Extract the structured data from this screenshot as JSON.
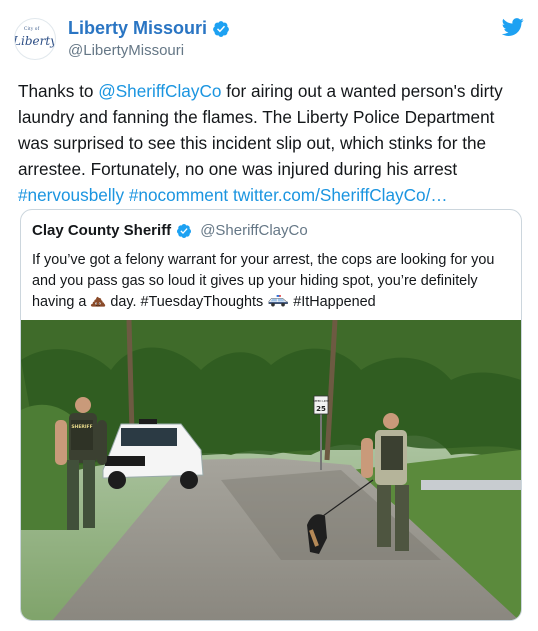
{
  "account": {
    "display_name": "Liberty Missouri",
    "handle": "@LibertyMissouri",
    "avatar_small_text": "City of",
    "avatar_script_text": "Liberty"
  },
  "tweet": {
    "text_before_mention": "Thanks to ",
    "mention": "@SheriffClayCo",
    "text_after_mention": " for airing out a wanted person's dirty laundry and fanning the flames. The Liberty Police Department was surprised to see this incident slip out, which stinks for the arrestee. Fortunately, no one was injured during his arrest ",
    "hashtag_1": "#nervousbelly",
    "hashtag_2": "#nocomment",
    "link": "twitter.com/SheriffClayCo/…"
  },
  "quoted_tweet": {
    "display_name": "Clay County Sheriff",
    "handle": "@SheriffClayCo",
    "text_part_1": "If you’ve got a felony warrant for your arrest, the cops are looking for you and you pass gas so loud it gives up your hiding spot, you’re definitely having a ",
    "text_part_2": " day. #TuesdayThoughts ",
    "text_part_3": " #ItHappened"
  },
  "photo": {
    "speed_sign_label": "SPEED LIMIT",
    "speed_sign_value": "25",
    "badge_text": "SHERIFF"
  },
  "colors": {
    "brand_blue": "#1da1f2",
    "name_blue": "#2a75c3",
    "link_blue": "#1b95e0",
    "muted": "#657786",
    "border": "#ccd6dd"
  },
  "icons": [
    "verified-badge-icon",
    "twitter-bird-icon",
    "poop-emoji-icon",
    "police-car-emoji-icon"
  ]
}
